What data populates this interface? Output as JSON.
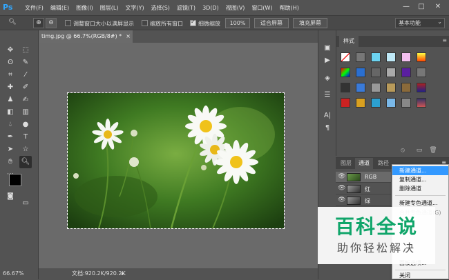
{
  "app": {
    "logo": "Ps"
  },
  "menu": [
    "文件(F)",
    "编辑(E)",
    "图像(I)",
    "图层(L)",
    "文字(Y)",
    "选择(S)",
    "滤镜(T)",
    "3D(D)",
    "视图(V)",
    "窗口(W)",
    "帮助(H)"
  ],
  "window_controls": {
    "minimize": "—",
    "restore": "□",
    "close": "✕"
  },
  "options": {
    "resize_windows_label": "调整窗口大小以满屏显示",
    "resize_windows_checked": false,
    "zoom_all_label": "缩放所有窗口",
    "zoom_all_checked": false,
    "scrubby_zoom_label": "细微缩放",
    "scrubby_zoom_checked": true,
    "zoom_percent_button": "100%",
    "fit_screen_button": "适合屏幕",
    "fill_screen_button": "填充屏幕",
    "workspace": "基本功能"
  },
  "document": {
    "tab_title": "timg.jpg @ 66.7%(RGB/8#) *",
    "tab_close": "×",
    "zoom": "66.67%",
    "doc_info": "文档:920.2K/920.2K"
  },
  "styles_panel": {
    "tab": "样式"
  },
  "channels_panel": {
    "tabs": [
      "图层",
      "通道",
      "路径"
    ],
    "active_tab": 1,
    "channels": [
      {
        "name": "RGB",
        "selected": true
      },
      {
        "name": "红",
        "selected": false
      },
      {
        "name": "绿",
        "selected": false
      }
    ]
  },
  "context_menu": {
    "items": [
      {
        "label": "新建通道...",
        "highlight": true
      },
      {
        "label": "复制通道..."
      },
      {
        "label": "删除通道"
      },
      {
        "label": "新建专色通道..."
      },
      {
        "label": "合并专色通道(G)",
        "disabled": true
      },
      {
        "label": "面板选项..."
      },
      {
        "label": "关闭"
      }
    ]
  },
  "watermark": {
    "title": "百科全说",
    "subtitle": "助你轻松解决"
  },
  "colors": {
    "accent": "#31a8ff",
    "menu_highlight": "#3399ff",
    "watermark_green": "#10a56a"
  }
}
